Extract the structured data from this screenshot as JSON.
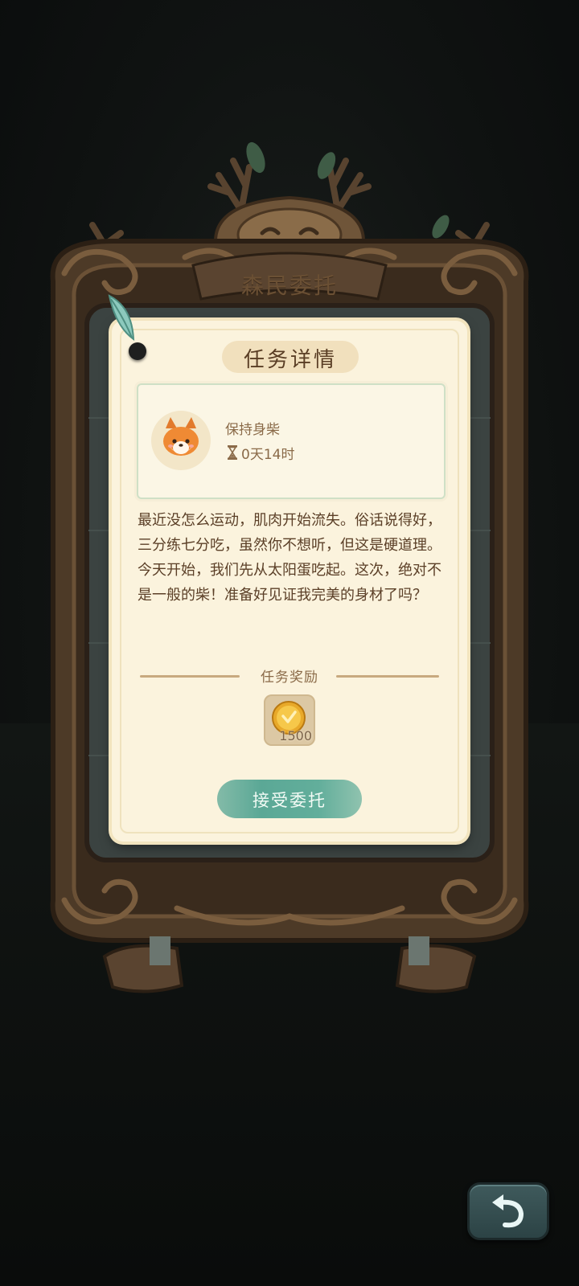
{
  "frame": {
    "title": "森民委托"
  },
  "note": {
    "title": "任务详情"
  },
  "quest": {
    "name": "保持身柴",
    "time_left": "0天14时",
    "avatar_icon": "shiba-dog-icon",
    "timer_icon": "hourglass-icon"
  },
  "description": "最近没怎么运动，肌肉开始流失。俗话说得好，三分练七分吃，虽然你不想听，但这是硬道理。今天开始，我们先从太阳蛋吃起。这次，绝对不是一般的柴！准备好见证我完美的身材了吗？",
  "reward": {
    "label": "任务奖励",
    "item_icon": "gold-coin-icon",
    "quantity": "1500"
  },
  "actions": {
    "accept_label": "接受委托",
    "back_icon": "back-arrow-icon"
  },
  "colors": {
    "paper": "#fbf3dd",
    "accent_green": "#5ba896",
    "text_brown": "#5b3f27"
  }
}
